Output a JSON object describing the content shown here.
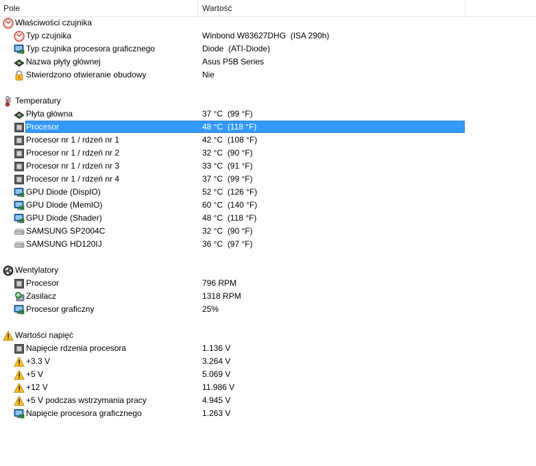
{
  "columns": {
    "field": "Pole",
    "value": "Wartość"
  },
  "sections": [
    {
      "title": "Właściwości czujnika",
      "icon": "sensor-icon",
      "rows": [
        {
          "icon": "sensor-icon",
          "label": "Typ czujnika",
          "value": "Winbond W83627DHG  (ISA 290h)"
        },
        {
          "icon": "monitor-gpu-icon",
          "label": "Typ czujnika procesora graficznego",
          "value": "Diode  (ATI-Diode)"
        },
        {
          "icon": "motherboard-icon",
          "label": "Nazwa płyty głównej",
          "value": "Asus P5B Series"
        },
        {
          "icon": "lock-icon",
          "label": "Stwierdzono otwieranie obudowy",
          "value": "Nie"
        }
      ]
    },
    {
      "title": "Temperatury",
      "icon": "thermometer-icon",
      "rows": [
        {
          "icon": "motherboard-icon",
          "label": "Płyta główna",
          "value": "37 °C  (99 °F)"
        },
        {
          "icon": "cpu-icon",
          "label": "Procesor",
          "value": "48 °C  (118 °F)",
          "selected": true
        },
        {
          "icon": "cpu-icon",
          "label": "Procesor nr 1 / rdzeń nr 1",
          "value": "42 °C  (108 °F)"
        },
        {
          "icon": "cpu-icon",
          "label": "Procesor nr 1 / rdzeń nr 2",
          "value": "32 °C  (90 °F)"
        },
        {
          "icon": "cpu-icon",
          "label": "Procesor nr 1 / rdzeń nr 3",
          "value": "33 °C  (91 °F)"
        },
        {
          "icon": "cpu-icon",
          "label": "Procesor nr 1 / rdzeń nr 4",
          "value": "37 °C  (99 °F)"
        },
        {
          "icon": "monitor-gpu-icon",
          "label": "GPU Diode (DispIO)",
          "value": "52 °C  (126 °F)"
        },
        {
          "icon": "monitor-gpu-icon",
          "label": "GPU Diode (MemIO)",
          "value": "60 °C  (140 °F)"
        },
        {
          "icon": "monitor-gpu-icon",
          "label": "GPU Diode (Shader)",
          "value": "48 °C  (118 °F)"
        },
        {
          "icon": "hard-drive-icon",
          "label": "SAMSUNG SP2004C",
          "value": "32 °C  (90 °F)"
        },
        {
          "icon": "hard-drive-icon",
          "label": "SAMSUNG HD120IJ",
          "value": "36 °C  (97 °F)"
        }
      ]
    },
    {
      "title": "Wentylatory",
      "icon": "fan-icon",
      "rows": [
        {
          "icon": "cpu-icon",
          "label": "Procesor",
          "value": "796 RPM"
        },
        {
          "icon": "power-supply-icon",
          "label": "Zasilacz",
          "value": "1318 RPM"
        },
        {
          "icon": "monitor-gpu-icon",
          "label": "Procesor graficzny",
          "value": "25%"
        }
      ]
    },
    {
      "title": "Wartości napięć",
      "icon": "warning-icon",
      "rows": [
        {
          "icon": "cpu-icon",
          "label": "Napięcie rdzenia procesora",
          "value": "1.136 V"
        },
        {
          "icon": "warning-icon",
          "label": "+3.3 V",
          "value": "3.264 V"
        },
        {
          "icon": "warning-icon",
          "label": "+5 V",
          "value": "5.069 V"
        },
        {
          "icon": "warning-icon",
          "label": "+12 V",
          "value": "11.986 V"
        },
        {
          "icon": "warning-icon",
          "label": "+5 V podczas wstrzymania pracy",
          "value": "4.945 V"
        },
        {
          "icon": "monitor-gpu-icon",
          "label": "Napięcie procesora graficznego",
          "value": "1.263 V"
        }
      ]
    }
  ],
  "colors": {
    "selection": "#3399ff",
    "header_border": "#e5e5e5"
  }
}
